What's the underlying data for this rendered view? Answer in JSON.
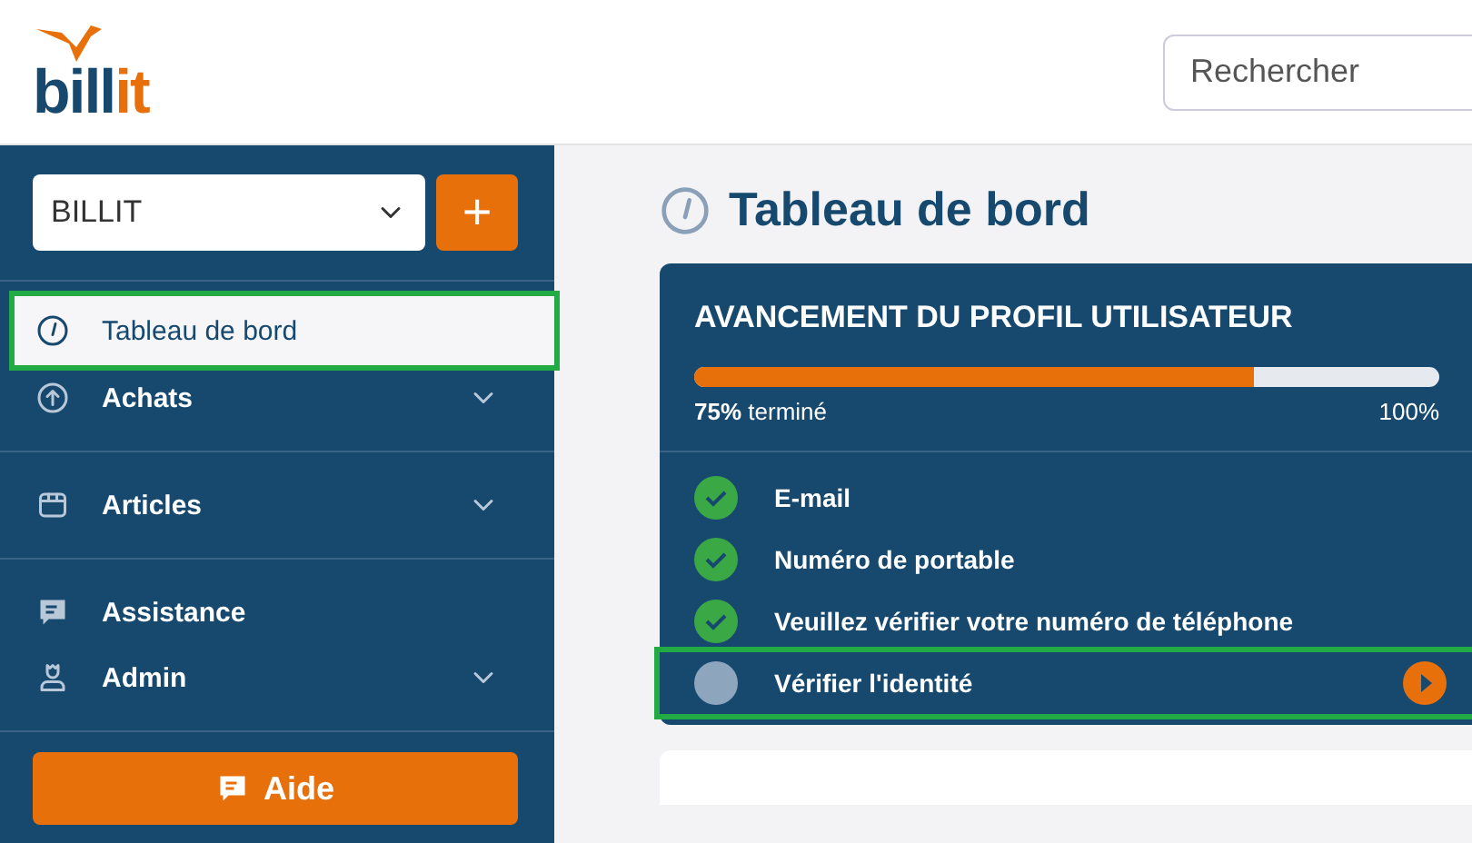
{
  "logo": {
    "parts": [
      {
        "text": "bill",
        "color": "#17496f"
      },
      {
        "text": "it",
        "color": "#e8700a"
      }
    ]
  },
  "search": {
    "placeholder": "Rechercher"
  },
  "company_select": {
    "value": "BILLIT"
  },
  "add_button": {
    "label": "+"
  },
  "nav": [
    {
      "label": "Tableau de bord",
      "kind": "gauge",
      "selected": true,
      "highlighted": true,
      "expandable": false,
      "divider_after": false
    },
    {
      "label": "Achats",
      "kind": "upload",
      "selected": false,
      "highlighted": false,
      "expandable": true,
      "divider_after": true
    },
    {
      "label": "Articles",
      "kind": "box",
      "selected": false,
      "highlighted": false,
      "expandable": true,
      "divider_after": true
    },
    {
      "label": "Assistance",
      "kind": "chat",
      "selected": false,
      "highlighted": false,
      "expandable": false,
      "divider_after": false
    },
    {
      "label": "Admin",
      "kind": "user",
      "selected": false,
      "highlighted": false,
      "expandable": true,
      "divider_after": true
    }
  ],
  "help_button": {
    "label": "Aide"
  },
  "page_title": "Tableau de bord",
  "profile_card": {
    "title": "AVANCEMENT DU PROFIL UTILISATEUR",
    "level": 0.75,
    "done_value": "75%",
    "done_label": "terminé",
    "max_label": "100%",
    "steps": [
      {
        "label": "E-mail",
        "checked": true,
        "highlighted": false
      },
      {
        "label": "Numéro de portable",
        "checked": true,
        "highlighted": false
      },
      {
        "label": "Veuillez vérifier votre numéro de téléphone",
        "checked": true,
        "highlighted": false
      },
      {
        "label": "Vérifier l'identité",
        "checked": false,
        "highlighted": true
      }
    ]
  }
}
